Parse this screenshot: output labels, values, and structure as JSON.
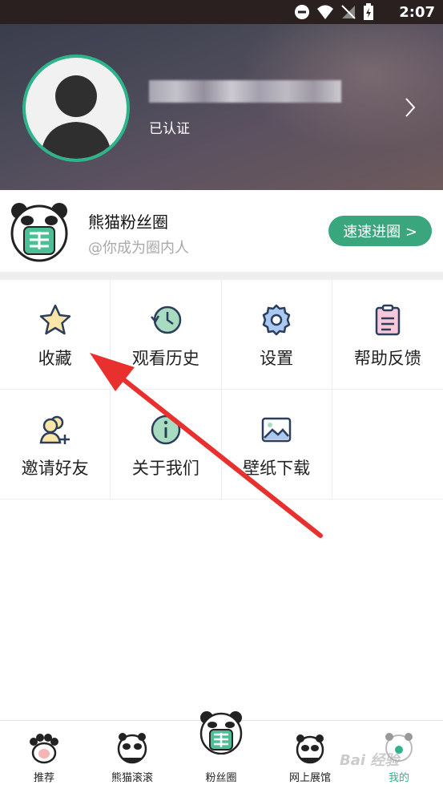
{
  "status_bar": {
    "time": "2:07"
  },
  "profile": {
    "verified_label": "已认证"
  },
  "fan_circle": {
    "title": "熊猫粉丝圈",
    "subtitle": "@你成为圈内人",
    "button_label": "速速进圈 >"
  },
  "menu": {
    "items": [
      {
        "label": "收藏",
        "icon": "star-icon"
      },
      {
        "label": "观看历史",
        "icon": "history-icon"
      },
      {
        "label": "设置",
        "icon": "gear-icon"
      },
      {
        "label": "帮助反馈",
        "icon": "clipboard-icon"
      },
      {
        "label": "邀请好友",
        "icon": "add-user-icon"
      },
      {
        "label": "关于我们",
        "icon": "info-icon"
      },
      {
        "label": "壁纸下载",
        "icon": "image-icon"
      }
    ]
  },
  "tabbar": {
    "tabs": [
      {
        "label": "推荐",
        "active": false
      },
      {
        "label": "熊猫滚滚",
        "active": false
      },
      {
        "label": "粉丝圈",
        "active": false
      },
      {
        "label": "网上展馆",
        "active": false
      },
      {
        "label": "我的",
        "active": true
      }
    ]
  },
  "watermark": "Bai 经验",
  "colors": {
    "accent": "#2db48a",
    "button": "#3aa67e",
    "annotation_arrow": "#e8312f"
  }
}
